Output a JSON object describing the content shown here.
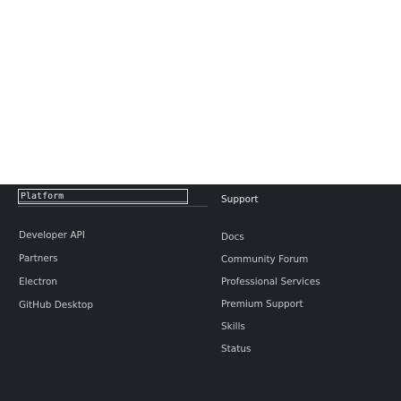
{
  "footer": {
    "platform_dropdown": {
      "value": "Platform"
    },
    "left_links": [
      {
        "label": "Developer API"
      },
      {
        "label": "Partners"
      },
      {
        "label": "Electron"
      },
      {
        "label": "GitHub Desktop"
      }
    ],
    "right_heading": "Support",
    "right_links": [
      {
        "label": "Docs"
      },
      {
        "label": "Community Forum"
      },
      {
        "label": "Professional Services"
      },
      {
        "label": "Premium Support"
      },
      {
        "label": "Skills"
      },
      {
        "label": "Status"
      }
    ]
  },
  "colors": {
    "panel_background": "#1f2328",
    "link_text": "#c3c8cf",
    "heading_text": "#e6e9ed",
    "page_background": "#ffffff"
  }
}
